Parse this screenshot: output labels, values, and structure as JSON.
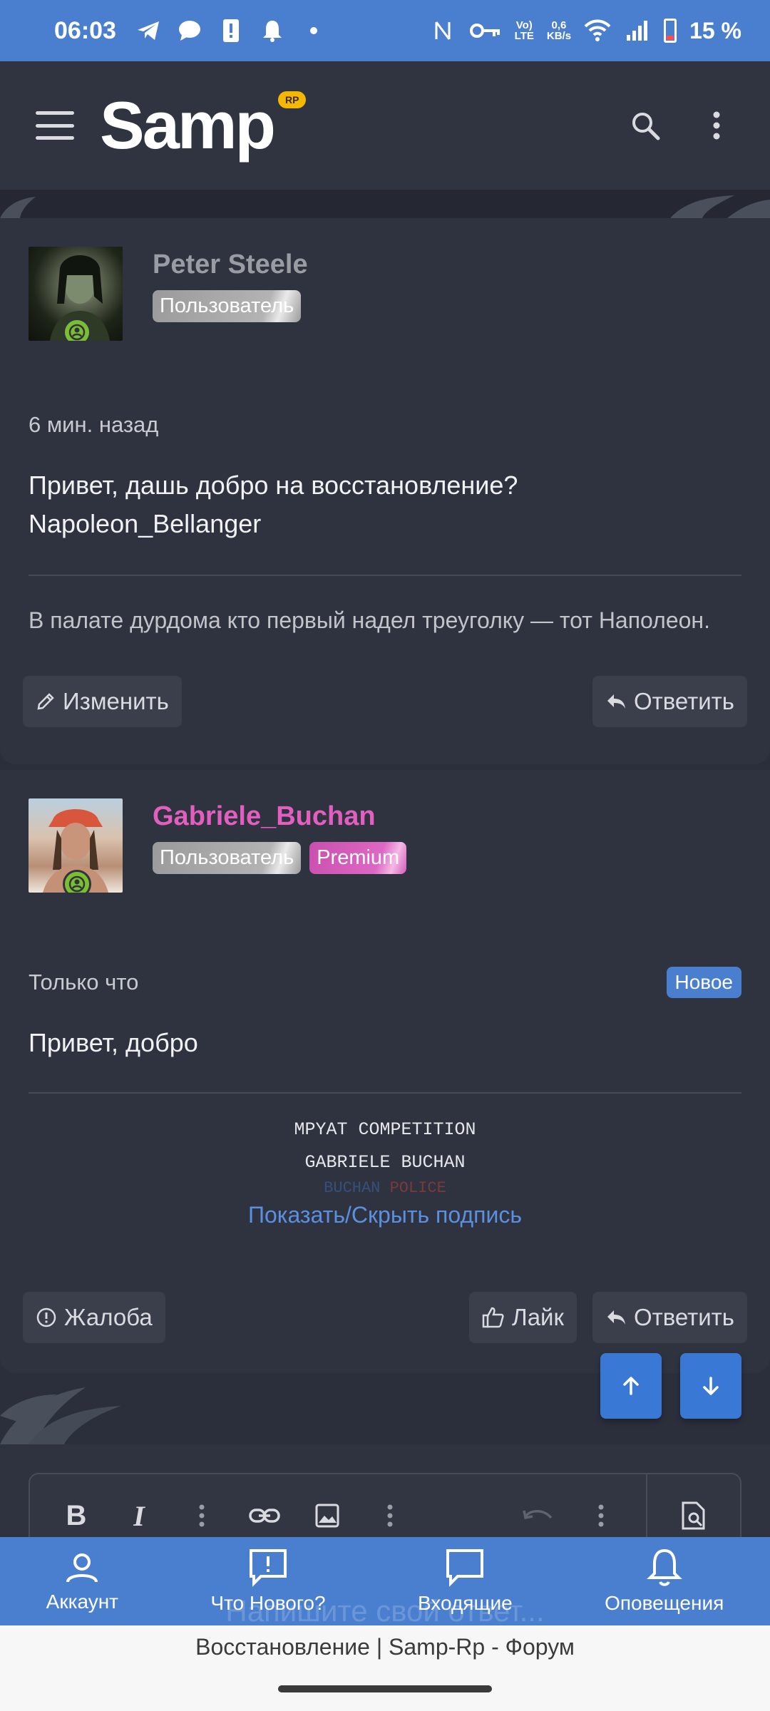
{
  "status_bar": {
    "time": "06:03",
    "net_speed_value": "0,6",
    "net_speed_unit": "KB/s",
    "volte_top": "Vo)",
    "volte_bottom": "LTE",
    "battery_percent": "15 %"
  },
  "header": {
    "logo_text": "Samp",
    "logo_badge": "RP"
  },
  "posts": [
    {
      "author": "Peter Steele",
      "badges": [
        "Пользователь"
      ],
      "time": "6 мин. назад",
      "body_line1": "Привет, дашь добро на восстановление?",
      "body_line2": "Napoleon_Bellanger",
      "signature": "В палате дурдома кто первый надел треуголку — тот Наполеон.",
      "actions": {
        "edit": "Изменить",
        "reply": "Ответить"
      }
    },
    {
      "author": "Gabriele_Buchan",
      "badges": [
        "Пользователь",
        "Premium"
      ],
      "time": "Только что",
      "new_label": "Новое",
      "body": "Привет, добро",
      "signature_lines": [
        "MPYAT COMPETITION",
        "GABRIELE BUCHAN"
      ],
      "signature_line3_a": "BUCHAN",
      "signature_line3_b": "POLICE",
      "toggle_signature": "Показать/Скрыть подпись",
      "actions": {
        "report": "Жалоба",
        "like": "Лайк",
        "reply": "Ответить"
      }
    }
  ],
  "editor": {
    "placeholder": "Напишите свой ответ..."
  },
  "bottom_nav": {
    "items": [
      {
        "label": "Аккаунт",
        "icon": "user-icon"
      },
      {
        "label": "Что Нового?",
        "icon": "whats-new-icon"
      },
      {
        "label": "Входящие",
        "icon": "inbox-icon"
      },
      {
        "label": "Оповещения",
        "icon": "bell-icon"
      }
    ]
  },
  "browser_footer": {
    "title": "Восстановление | Samp-Rp - Форум"
  },
  "colors": {
    "accent": "#4a7fd0",
    "premium": "#e25fbf",
    "background": "#2b2f3b"
  }
}
